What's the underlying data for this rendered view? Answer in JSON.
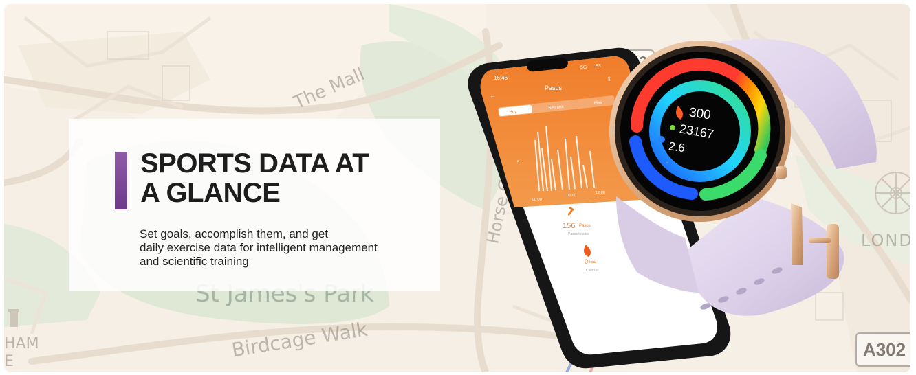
{
  "map": {
    "labels": {
      "the_mall": "The Mall",
      "st_james_park": "St James's Park",
      "birdcage_walk": "Birdcage Walk",
      "horse_guards": "Horse Gu",
      "london": "LONDO",
      "ham_line1": "HAM",
      "ham_line2": "E"
    },
    "road_badges": {
      "a302": "A302",
      "b812": "812"
    }
  },
  "hero": {
    "headline_line1": "SPORTS DATA AT",
    "headline_line2": "A GLANCE",
    "subtitle_line1": "Set goals, accomplish them, and get",
    "subtitle_line2": "daily exercise data for intelligent management",
    "subtitle_line3": "and scientific training",
    "accent_color": "#7a4697"
  },
  "phone_app": {
    "time": "16:46",
    "signal": "5G",
    "battery": "83",
    "title": "Pasos",
    "tabs": [
      "Hoy",
      "Semana",
      "Mes"
    ],
    "active_tab": "Hoy",
    "y_axis": [
      "5"
    ],
    "x_axis": [
      "00:00",
      "06:00",
      "12:00"
    ],
    "steps_value": "156",
    "steps_unit": "Pasos",
    "steps_caption": "Pasos totales",
    "calories_value": "0",
    "calories_unit": "kcal",
    "calories_caption": "Calorías",
    "brand_color": "#f07d2a"
  },
  "watch": {
    "calories": "300",
    "steps": "23167",
    "distance": "2.6"
  }
}
